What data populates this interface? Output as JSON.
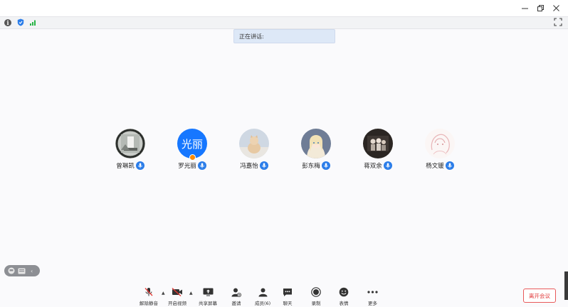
{
  "window": {
    "minimize_icon": "minimize-icon",
    "restore_icon": "restore-icon",
    "close_icon": "close-icon"
  },
  "statusbar": {
    "info_glyph": "i",
    "icons": [
      "info-icon",
      "shield-icon",
      "signal-icon",
      "fullscreen-icon"
    ]
  },
  "speaking": {
    "label": "正在讲话:"
  },
  "participants": [
    {
      "name": "曾琳凯",
      "avatar": "photo"
    },
    {
      "name": "罗光丽",
      "avatar": "text",
      "avatar_text": "光丽",
      "host": true
    },
    {
      "name": "冯嘉怡",
      "avatar": "photo"
    },
    {
      "name": "彭东梅",
      "avatar": "photo"
    },
    {
      "name": "蒋双余",
      "avatar": "photo"
    },
    {
      "name": "杨文锾",
      "avatar": "photo"
    }
  ],
  "toolbar": {
    "unmute": "解除静音",
    "start_video": "开启视频",
    "share_screen": "共享屏幕",
    "invite": "邀请",
    "members": "成员(6)",
    "chat": "聊天",
    "record": "录制",
    "reactions": "表情",
    "more": "更多"
  },
  "leave_button": "离开会议",
  "colors": {
    "accent": "#2b7de9",
    "avatar_blue": "#1677ff",
    "leave_red": "#e0393a",
    "speaking_bg": "#dde8f7"
  }
}
